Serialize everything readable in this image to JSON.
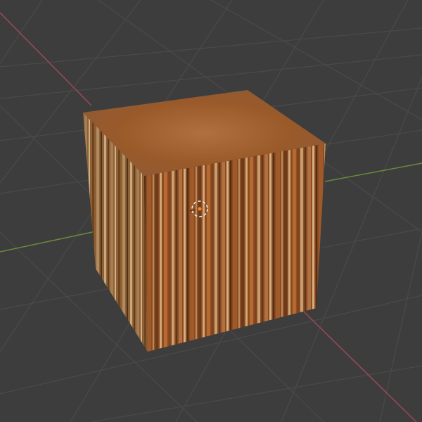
{
  "colors": {
    "background": "#3d3d3d",
    "grid": "#4a4a4a",
    "x_axis": "#9a4a55",
    "y_axis": "#6a8a3a",
    "cursor_ring": "#e8e8e8",
    "cursor_dot": "#f08a20",
    "wood_light": "#c8a070",
    "wood_mid": "#9a5a2a",
    "wood_dark": "#5a3418",
    "top_surface": "#a8683a"
  },
  "icons": {
    "cursor": "3d-cursor-icon"
  }
}
